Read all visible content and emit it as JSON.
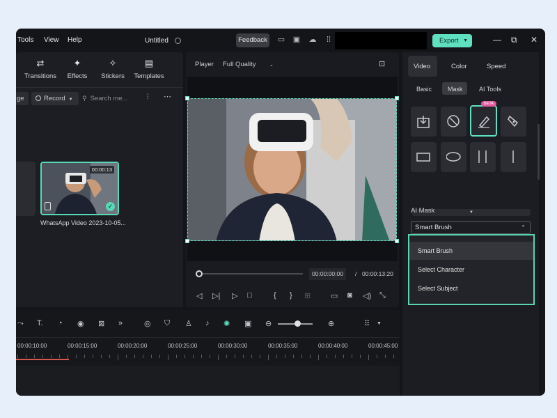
{
  "menu": {
    "tools": "Tools",
    "view": "View",
    "help": "Help"
  },
  "title": "Untitled",
  "feedback_label": "Feedback",
  "export_label": "Export",
  "window_controls": {
    "minimize": "—",
    "restore": "⧉",
    "close": "✕"
  },
  "toolbar": [
    {
      "icon": "transitions-icon",
      "label": "Transitions"
    },
    {
      "icon": "effects-icon",
      "label": "Effects"
    },
    {
      "icon": "stickers-icon",
      "label": "Stickers"
    },
    {
      "icon": "templates-icon",
      "label": "Templates"
    }
  ],
  "media": {
    "partial_chip": "ge",
    "record_label": "Record",
    "search_placeholder": "Search me...",
    "clip": {
      "duration": "00:00:13",
      "name": "WhatsApp Video 2023-10-05..."
    }
  },
  "player": {
    "label": "Player",
    "quality": "Full Quality",
    "current_time": "00:00:00:00",
    "total_time": "00:00:13:20",
    "separator": "/",
    "progress": 0
  },
  "inspector": {
    "tabs": [
      "Video",
      "Color",
      "Speed"
    ],
    "active_tab": "Video",
    "subtabs": [
      "Basic",
      "Mask",
      "AI Tools"
    ],
    "active_subtab": "Mask",
    "beta_badge": "BETA",
    "ai_mask_label": "AI Mask",
    "selected_option": "Smart Brush",
    "options": [
      "Smart Brush",
      "Select Character",
      "Select Subject"
    ]
  },
  "timeline": {
    "ticks": [
      "00:00:10:00",
      "00:00:15:00",
      "00:00:20:00",
      "00:00:25:00",
      "00:00:30:00",
      "00:00:35:00",
      "00:00:40:00",
      "00:00:45:00"
    ]
  },
  "colors": {
    "accent": "#5fe0c0",
    "background": "#141519",
    "playhead": "#d4564f"
  }
}
